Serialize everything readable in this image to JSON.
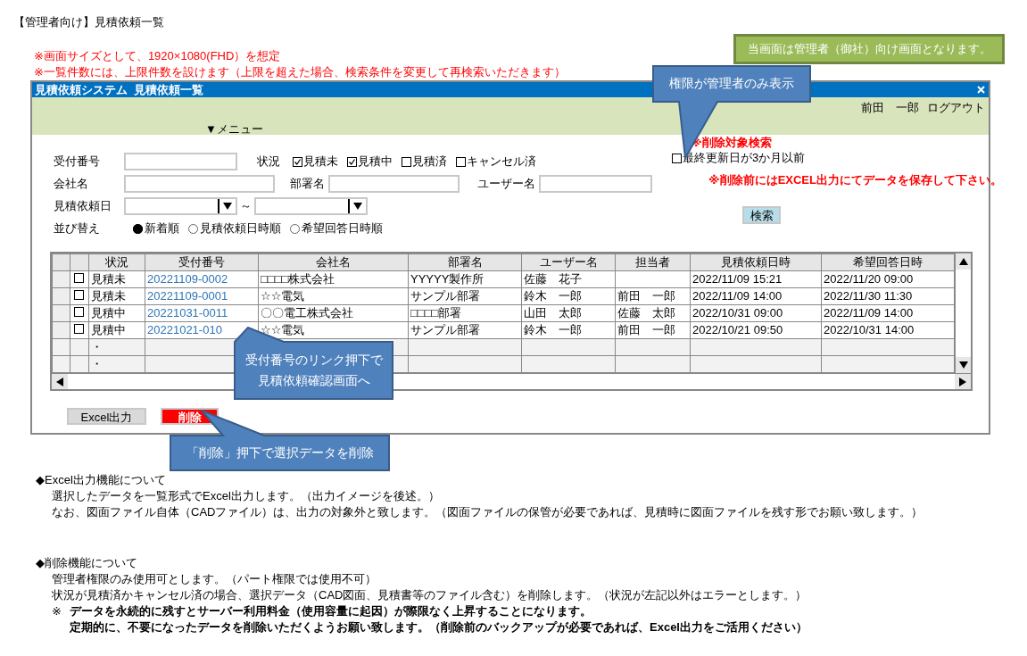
{
  "page_title": "【管理者向け】見積依頼一覧",
  "notes": [
    "※画面サイズとして、1920×1080(FHD）を想定",
    "※一覧件数には、上限件数を設けます（上限を超えた場合、検索条件を変更して再検索いただきます）"
  ],
  "banner": "当画面は管理者（御社）向け画面となります。",
  "window": {
    "title": "見積依頼システム  見積依頼一覧",
    "user": "前田　一郎",
    "logout": "ログアウト",
    "menu": "▼メニュー"
  },
  "search": {
    "receipt_label": "受付番号",
    "status_label": "状況",
    "status_filters": [
      {
        "label": "見積未",
        "checked": true
      },
      {
        "label": "見積中",
        "checked": true
      },
      {
        "label": "見積済",
        "checked": false
      },
      {
        "label": "キャンセル済",
        "checked": false
      }
    ],
    "company_label": "会社名",
    "department_label": "部署名",
    "user_label": "ユーザー名",
    "date_label": "見積依頼日",
    "date_separator": "～",
    "sort_label": "並び替え",
    "sort_options": [
      {
        "label": "新着順",
        "selected": true
      },
      {
        "label": "見積依頼日時順",
        "selected": false
      },
      {
        "label": "希望回答日時順",
        "selected": false
      }
    ],
    "delete_search": {
      "heading": "※削除対象検索",
      "option": {
        "label": "最終更新日が3か月以前",
        "checked": false
      },
      "warning": "※削除前にはEXCEL出力にてデータを保存して下さい。"
    },
    "search_button": "検索"
  },
  "table": {
    "columns": [
      "状況",
      "受付番号",
      "会社名",
      "部署名",
      "ユーザー名",
      "担当者",
      "見積依頼日時",
      "希望回答日時"
    ],
    "rows": [
      {
        "selected": false,
        "status": "見積未",
        "number": "20221109-0002",
        "company": "□□□□株式会社",
        "department": "YYYYY製作所",
        "user": "佐藤　花子",
        "requested": "2022/11/09 15:21",
        "desired": "2022/11/20 09:00"
      },
      {
        "selected": false,
        "status": "見積未",
        "number": "20221109-0001",
        "company": "☆☆電気",
        "department": "サンプル部署",
        "user": "鈴木　一郎",
        "staff": "前田　一郎",
        "requested": "2022/11/09 14:00",
        "desired": "2022/11/30 11:30"
      },
      {
        "selected": false,
        "status": "見積中",
        "number": "20221031-0011",
        "company": "〇〇電工株式会社",
        "department": "□□□□部署",
        "user": "山田　太郎",
        "staff": "佐藤　太郎",
        "requested": "2022/10/31 09:00",
        "desired": "2022/11/09 14:00"
      },
      {
        "selected": false,
        "status": "見積中",
        "number": "20221021-010",
        "company": "☆☆電気",
        "department": "サンプル部署",
        "user": "鈴木　一郎",
        "staff": "前田　一郎",
        "requested": "2022/10/21 09:50",
        "desired": "2022/10/31 14:00"
      }
    ],
    "continuation_rows": [
      "・",
      "・"
    ]
  },
  "buttons": [
    {
      "kind": "excel",
      "label": "Excel出力"
    },
    {
      "kind": "delete",
      "label": "削除"
    }
  ],
  "callouts": [
    {
      "lines": [
        "権限が管理者のみ表示"
      ]
    },
    {
      "lines": [
        "受付番号のリンク押下で",
        "見積依頼確認画面へ"
      ]
    },
    {
      "lines": [
        "「削除」押下で選択データを削除"
      ]
    }
  ],
  "sections": [
    {
      "heading": "◆Excel出力機能について",
      "lines": [
        {
          "kind": "plain",
          "text": "選択したデータを一覧形式でExcel出力します。（出力イメージを後述。）"
        },
        {
          "kind": "plain",
          "text": "なお、図面ファイル自体（CADファイル）は、出力の対象外と致します。（図面ファイルの保管が必要であれば、見積時に図面ファイルを残す形でお願い致します。）"
        }
      ]
    },
    {
      "heading": "◆削除機能について",
      "lines": [
        {
          "kind": "plain",
          "text": "管理者権限のみ使用可とします。（パート権限では使用不可）"
        },
        {
          "kind": "plain",
          "text": "状況が見積済かキャンセル済の場合、選択データ（CAD図面、見積書等のファイル含む）を削除します。（状況が左記以外はエラーとします。）"
        },
        {
          "kind": "note",
          "mark": "※",
          "text": "データを永続的に残すとサーバー利用料金（使用容量に起因）が際限なく上昇することになります。"
        },
        {
          "kind": "note",
          "text": "定期的に、不要になったデータを削除いただくようお願い致します。（削除前のバックアップが必要であれば、Excel出力をご活用ください）"
        }
      ]
    }
  ]
}
